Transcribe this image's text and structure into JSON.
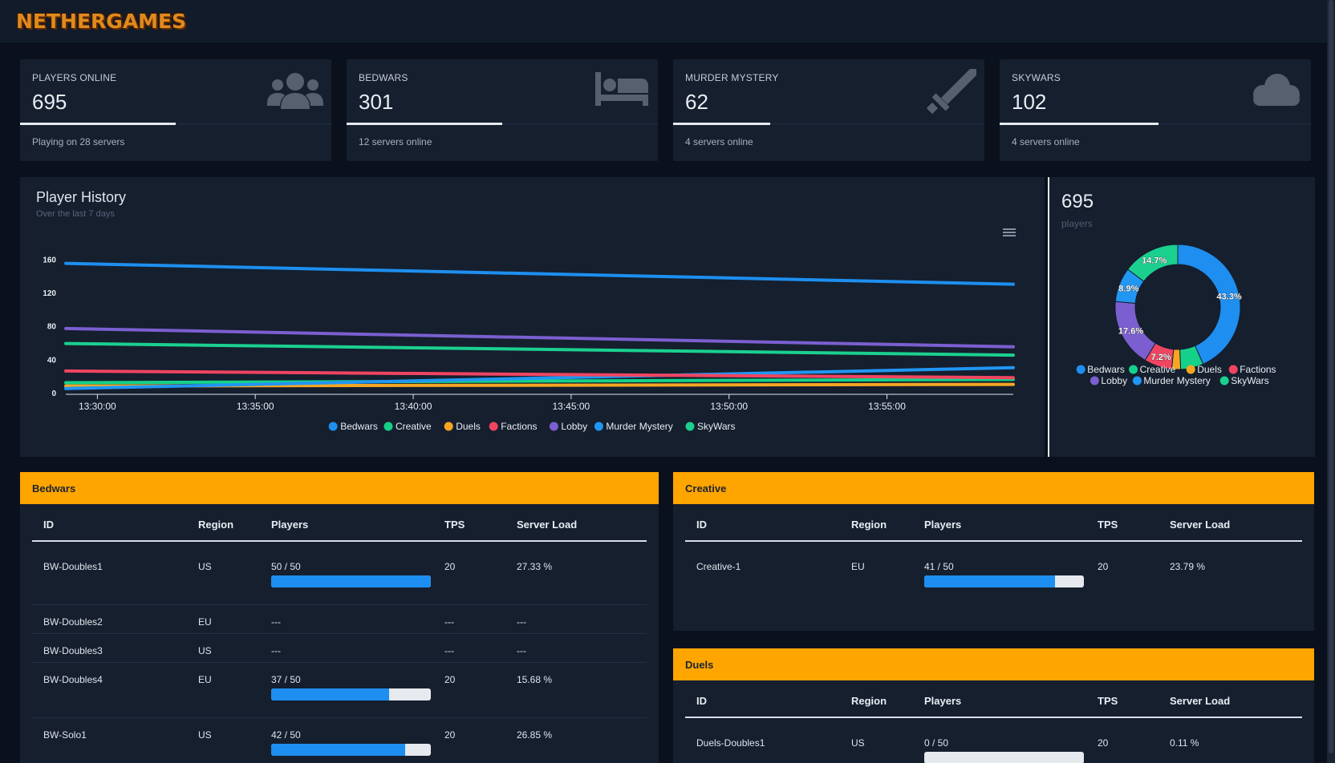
{
  "brand": {
    "logo_text": "NETHERGAMES"
  },
  "stats": [
    {
      "label": "PLAYERS ONLINE",
      "value": "695",
      "sub": "Playing on 28 servers",
      "icon": "users-icon",
      "bar_fraction": 0.5
    },
    {
      "label": "BEDWARS",
      "value": "301",
      "sub": "12 servers online",
      "icon": "bed-icon",
      "bar_fraction": 0.5
    },
    {
      "label": "MURDER MYSTERY",
      "value": "62",
      "sub": "4 servers online",
      "icon": "sword-icon",
      "bar_fraction": 0.3
    },
    {
      "label": "SKYWARS",
      "value": "102",
      "sub": "4 servers online",
      "icon": "cloud-icon",
      "bar_fraction": 0.5
    }
  ],
  "history": {
    "title": "Player History",
    "subtitle": "Over the last 7 days",
    "menu_icon": "hamburger-menu-icon"
  },
  "donut": {
    "value": "695",
    "unit": "players"
  },
  "colors": {
    "accent": "#ffa500",
    "Bedwars": "#1e8ff0",
    "Creative": "#14d18a",
    "Duels": "#f5a623",
    "Factions": "#ef4561",
    "Lobby": "#7b5fd0",
    "Murder Mystery": "#2196f3",
    "SkyWars": "#1bd08f"
  },
  "chart_data": [
    {
      "type": "line",
      "title": "Player History",
      "subtitle": "Over the last 7 days",
      "x": [
        "13:29:00",
        "13:59:00"
      ],
      "x_ticks": [
        "13:30:00",
        "13:35:00",
        "13:40:00",
        "13:45:00",
        "13:50:00",
        "13:55:00"
      ],
      "y_ticks": [
        "0",
        "40",
        "80",
        "120",
        "160"
      ],
      "ylim": [
        0,
        170
      ],
      "series": [
        {
          "name": "Bedwars",
          "values": [
            155,
            130
          ]
        },
        {
          "name": "Creative",
          "values": [
            12,
            16
          ]
        },
        {
          "name": "Duels",
          "values": [
            8,
            10
          ]
        },
        {
          "name": "Factions",
          "values": [
            26,
            18
          ]
        },
        {
          "name": "Lobby",
          "values": [
            77,
            55
          ]
        },
        {
          "name": "Murder Mystery",
          "values": [
            5,
            30
          ]
        },
        {
          "name": "SkyWars",
          "values": [
            59,
            45
          ]
        }
      ],
      "legend": "bottom",
      "grid": false
    },
    {
      "type": "pie",
      "categories": [
        "Bedwars",
        "Creative",
        "Duels",
        "Factions",
        "Lobby",
        "Murder Mystery",
        "SkyWars"
      ],
      "values": [
        43.3,
        5.9,
        2.3,
        7.2,
        17.6,
        8.9,
        14.7
      ],
      "data_labels": [
        "43.3%",
        "",
        "",
        "7.2%",
        "17.6%",
        "8.9%",
        "14.7%"
      ],
      "legend": "bottom"
    }
  ],
  "tables": [
    {
      "title": "Bedwars",
      "columns": [
        "ID",
        "Region",
        "Players",
        "TPS",
        "Server Load"
      ],
      "rows": [
        {
          "id": "BW-Doubles1",
          "region": "US",
          "players": "50 / 50",
          "fill": 1.0,
          "tps": "20",
          "load": "27.33 %"
        },
        {
          "id": "BW-Doubles2",
          "region": "EU",
          "players": "---",
          "fill": null,
          "tps": "---",
          "load": "---"
        },
        {
          "id": "BW-Doubles3",
          "region": "US",
          "players": "---",
          "fill": null,
          "tps": "---",
          "load": "---"
        },
        {
          "id": "BW-Doubles4",
          "region": "EU",
          "players": "37 / 50",
          "fill": 0.74,
          "tps": "20",
          "load": "15.68 %"
        },
        {
          "id": "BW-Solo1",
          "region": "US",
          "players": "42 / 50",
          "fill": 0.84,
          "tps": "20",
          "load": "26.85 %"
        }
      ]
    },
    {
      "title": "Creative",
      "columns": [
        "ID",
        "Region",
        "Players",
        "TPS",
        "Server Load"
      ],
      "rows": [
        {
          "id": "Creative-1",
          "region": "EU",
          "players": "41 / 50",
          "fill": 0.82,
          "tps": "20",
          "load": "23.79 %"
        }
      ]
    },
    {
      "title": "Duels",
      "columns": [
        "ID",
        "Region",
        "Players",
        "TPS",
        "Server Load"
      ],
      "rows": [
        {
          "id": "Duels-Doubles1",
          "region": "US",
          "players": "0 / 50",
          "fill": 0.0,
          "tps": "20",
          "load": "0.11 %"
        }
      ]
    }
  ]
}
